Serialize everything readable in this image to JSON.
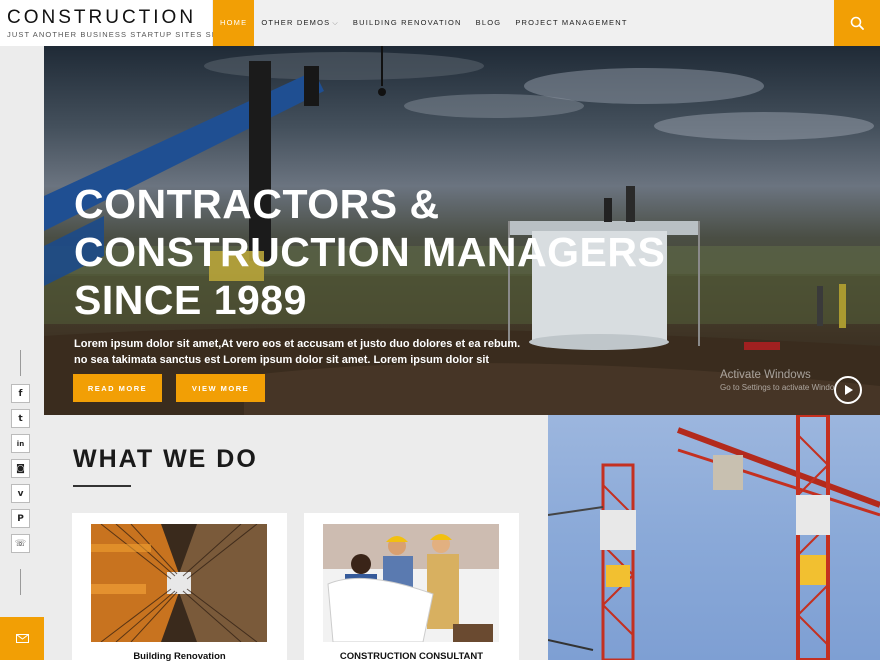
{
  "header": {
    "logo_title": "CONSTRUCTION",
    "logo_tagline": "JUST ANOTHER BUSINESS STARTUP SITES SITE",
    "nav": [
      {
        "label": "HOME",
        "active": true
      },
      {
        "label": "OTHER DEMOS",
        "active": false,
        "caret": "⌵"
      },
      {
        "label": "BUILDING RENOVATION",
        "active": false
      },
      {
        "label": "BLOG",
        "active": false
      },
      {
        "label": "PROJECT MANAGEMENT",
        "active": false
      }
    ],
    "search_icon": "search-icon"
  },
  "social": [
    {
      "icon": "facebook-icon",
      "glyph": "f"
    },
    {
      "icon": "twitter-icon",
      "glyph": "t"
    },
    {
      "icon": "linkedin-icon",
      "glyph": "in"
    },
    {
      "icon": "instagram-icon",
      "glyph": "◙"
    },
    {
      "icon": "vimeo-icon",
      "glyph": "v"
    },
    {
      "icon": "pinterest-icon",
      "glyph": "P"
    },
    {
      "icon": "whatsapp-icon",
      "glyph": "☏"
    }
  ],
  "hero": {
    "title_lines": [
      "CONTRACTORS &",
      "CONSTRUCTION MANAGERS",
      "SINCE 1989"
    ],
    "text": "Lorem ipsum dolor sit amet,At vero eos et accusam et justo duo dolores et ea rebum. no sea takimata sanctus est Lorem ipsum dolor sit amet. Lorem ipsum dolor sit",
    "btn_read": "READ MORE",
    "btn_view": "VIEW MORE"
  },
  "watermark": {
    "title": "Activate Windows",
    "sub": "Go to Settings to activate Windo"
  },
  "what": {
    "title": "WHAT WE DO",
    "cards": [
      {
        "label": "Building Renovation"
      },
      {
        "label": "CONSTRUCTION CONSULTANT"
      }
    ]
  },
  "colors": {
    "accent": "#f29f05",
    "rail": "#ececec",
    "header": "#f0f0f0"
  }
}
